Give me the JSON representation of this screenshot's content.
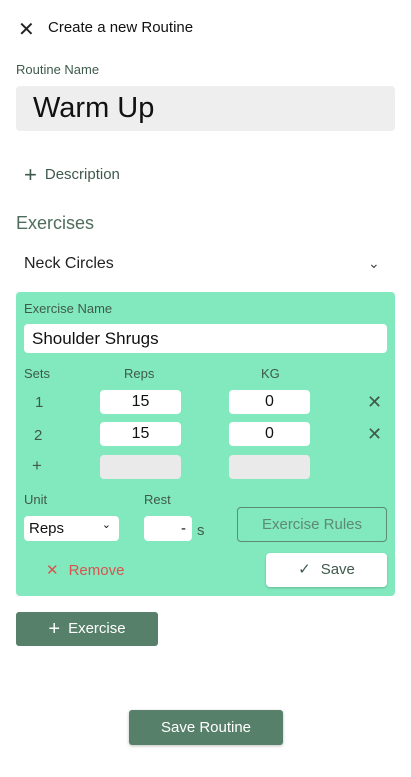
{
  "header": {
    "title": "Create a new Routine",
    "close_icon": "close-icon"
  },
  "routine_name": {
    "label": "Routine Name",
    "value": "Warm Up"
  },
  "description_label": "Description",
  "exercises": {
    "heading": "Exercises",
    "collapsed_item": "Neck Circles"
  },
  "editor": {
    "name_label": "Exercise Name",
    "name_value": "Shoulder Shrugs",
    "columns": [
      "Sets",
      "Reps",
      "KG"
    ],
    "sets": [
      {
        "set": "1",
        "reps": "15",
        "kg": "0"
      },
      {
        "set": "2",
        "reps": "15",
        "kg": "0"
      }
    ],
    "add_set": "+",
    "unit_label": "Unit",
    "unit_value": "Reps",
    "rest_label": "Rest",
    "rest_value": "-",
    "rest_unit": "s",
    "rules_label": "Exercise Rules",
    "remove_label": "Remove",
    "save_label": "Save"
  },
  "add_exercise_label": "Exercise",
  "save_routine_label": "Save Routine",
  "colors": {
    "card": "#82e8bd",
    "primary": "#568069",
    "danger": "#d9534f"
  }
}
